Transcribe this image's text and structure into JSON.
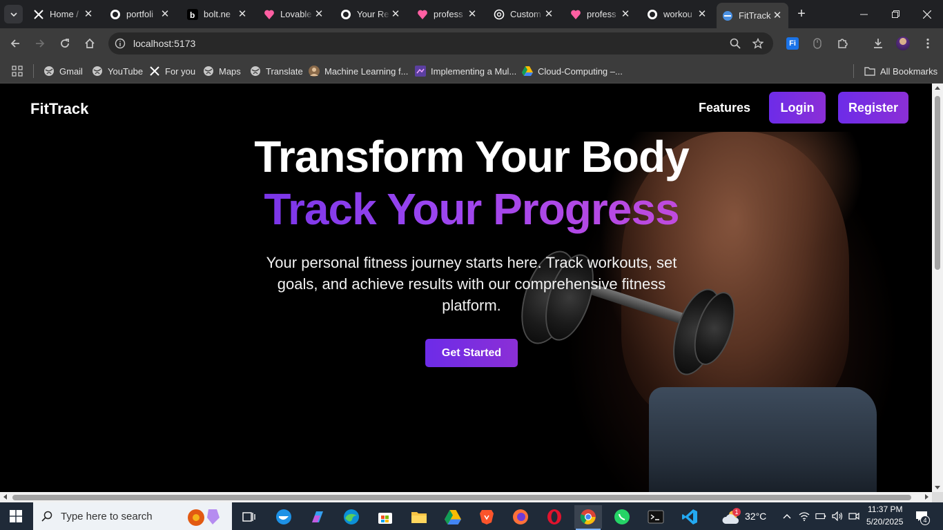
{
  "browser": {
    "tabs": [
      {
        "label": "Home /",
        "icon": "x-logo-icon"
      },
      {
        "label": "portfoli",
        "icon": "github-icon"
      },
      {
        "label": "bolt.ne",
        "icon": "bolt-icon"
      },
      {
        "label": "Lovable",
        "icon": "lovable-icon"
      },
      {
        "label": "Your Re",
        "icon": "github-icon"
      },
      {
        "label": "profess",
        "icon": "lovable-icon"
      },
      {
        "label": "Custom",
        "icon": "openai-icon"
      },
      {
        "label": "profess",
        "icon": "lovable-icon"
      },
      {
        "label": "workou",
        "icon": "github-icon"
      },
      {
        "label": "FitTrack",
        "icon": "fittrack-icon",
        "active": true
      }
    ],
    "url": "localhost:5173",
    "bookmarks": [
      "Gmail",
      "YouTube",
      "For you",
      "Maps",
      "Translate",
      "Machine Learning f...",
      "Implementing a Mul...",
      "Cloud-Computing –..."
    ],
    "all_bookmarks": "All Bookmarks"
  },
  "site": {
    "brand": "FitTrack",
    "nav": {
      "features": "Features",
      "login": "Login",
      "register": "Register"
    },
    "hero": {
      "title_line1": "Transform Your Body",
      "title_line2": "Track Your Progress",
      "subtitle": "Your personal fitness journey starts here. Track workouts, set goals, and achieve results with our comprehensive fitness platform.",
      "cta": "Get Started"
    }
  },
  "taskbar": {
    "search_placeholder": "Type here to search",
    "weather": "32°C",
    "weather_badge": "1",
    "time": "11:37 PM",
    "date": "5/20/2025",
    "notifications": "4"
  },
  "colors": {
    "accent_start": "#6d2ce8",
    "accent_end": "#8b2fd6",
    "gradient_text_end": "#c04bde"
  }
}
